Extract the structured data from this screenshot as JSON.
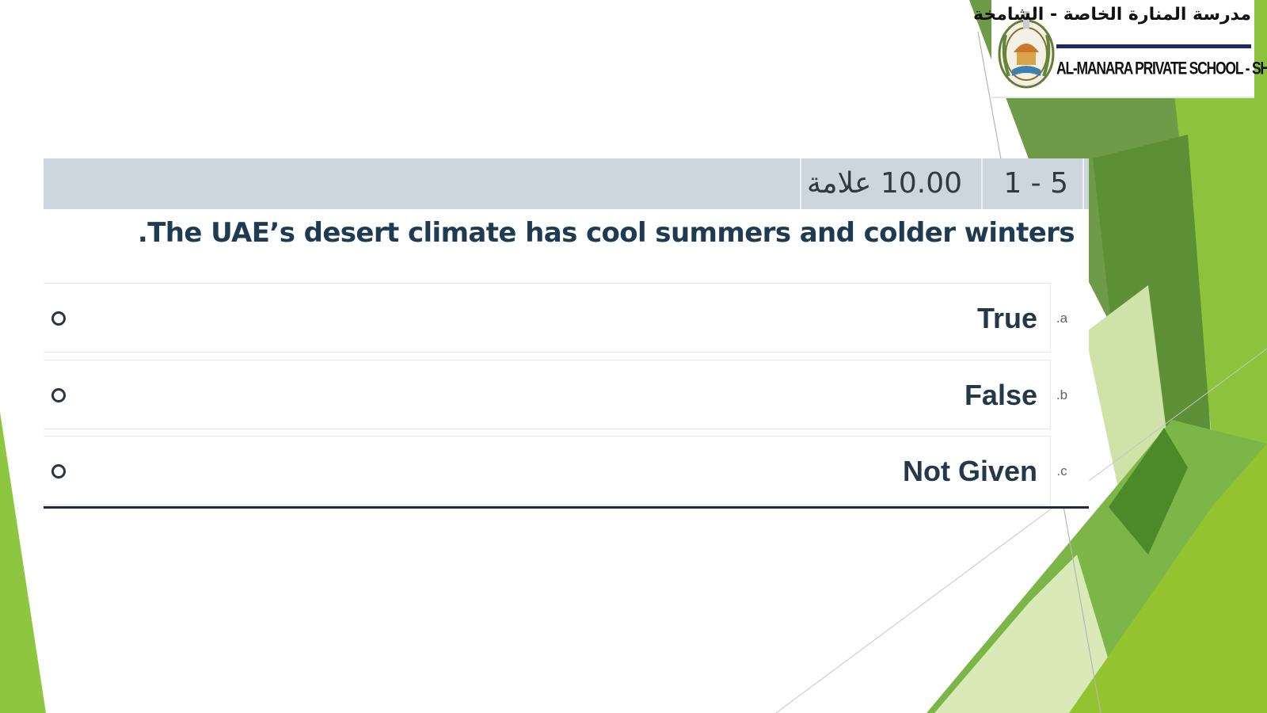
{
  "logo": {
    "arabic_name": "مدرسة المنارة الخاصة - الشامخة",
    "english_name": "AL-MANARA PRIVATE SCHOOL - SHAMKHA"
  },
  "question": {
    "number": "1 - 5",
    "marks": "10.00 علامة",
    "text": "The UAE’s desert climate has cool summers and colder winters.",
    "options": [
      {
        "letter": "a.",
        "label": "True"
      },
      {
        "letter": "b.",
        "label": "False"
      },
      {
        "letter": "c.",
        "label": "Not Given"
      }
    ]
  },
  "colors": {
    "header_bg": "#cdd6dd",
    "question_text": "#1f3b52",
    "accent_green": "#8dc63f",
    "dark_green": "#4e8a2a"
  }
}
